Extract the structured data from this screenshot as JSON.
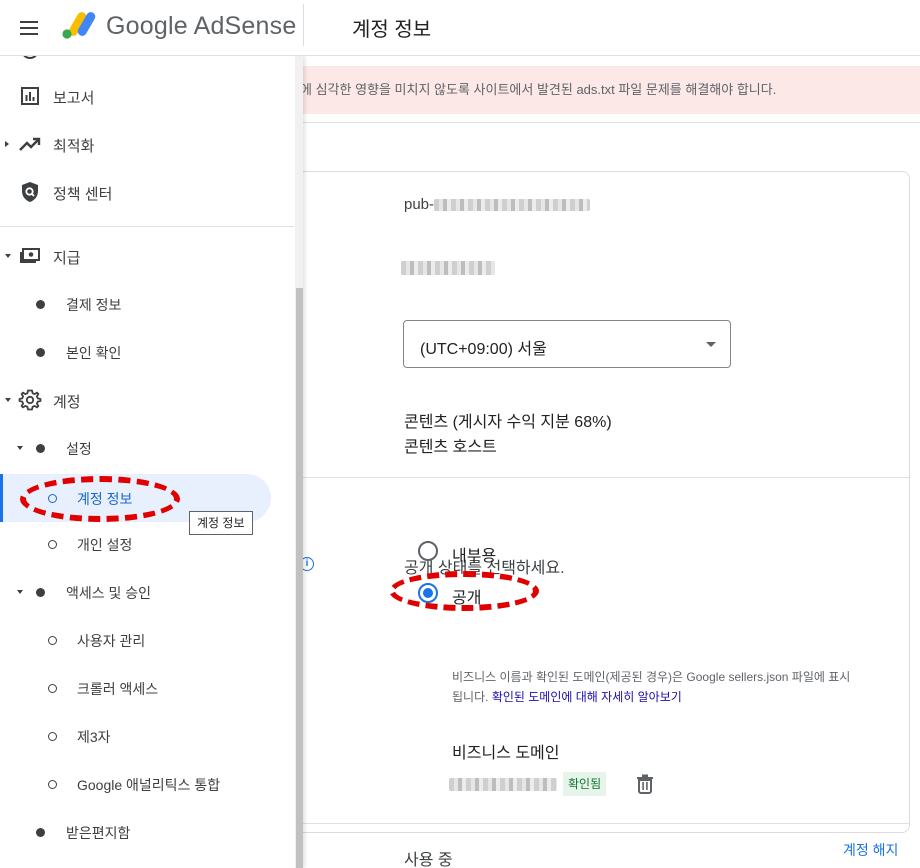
{
  "topbar": {
    "menu_icon": "hamburger-menu-icon",
    "brand": "Google AdSense",
    "page_title": "계정 정보"
  },
  "alert": {
    "text": "에 심각한 영향을 미치지 않도록 사이트에서 발견된 ads.txt 파일 문제를 해결해야 합니다."
  },
  "sidebar": {
    "items": [
      {
        "label": "보고서",
        "icon": "bar-chart-icon"
      },
      {
        "label": "최적화",
        "icon": "trending-up-icon"
      },
      {
        "label": "정책 센터",
        "icon": "policy-shield-icon"
      },
      {
        "label": "지급",
        "icon": "payments-icon"
      },
      {
        "label": "결제 정보"
      },
      {
        "label": "본인 확인"
      },
      {
        "label": "계정",
        "icon": "gear-icon"
      },
      {
        "label": "설정"
      },
      {
        "label": "계정 정보"
      },
      {
        "label": "개인 설정"
      },
      {
        "label": "액세스 및 승인"
      },
      {
        "label": "사용자 관리"
      },
      {
        "label": "크롤러 액세스"
      },
      {
        "label": "제3자"
      },
      {
        "label": "Google 애널리틱스 통합"
      },
      {
        "label": "받은편지함"
      }
    ],
    "tooltip": "계정 정보"
  },
  "account": {
    "publisher_id_prefix": "pub-",
    "timezone": "(UTC+09:00) 서울",
    "content_line1": "콘텐츠 (게시자 수익 지분 68%)",
    "content_line2": "콘텐츠 호스트",
    "visibility_prompt": "공개 상태를 선택하세요.",
    "visibility_options": [
      {
        "label": "내부용",
        "selected": false
      },
      {
        "label": "공개",
        "selected": true
      }
    ],
    "help_text": "비즈니스 이름과 확인된 도메인(제공된 경우)은 Google sellers.json 파일에 표시됩니다.",
    "help_link": "확인된 도메인에 대해 자세히 알아보기",
    "business_domain_title": "비즈니스 도메인",
    "verified_badge": "확인됨",
    "status": "사용 중",
    "close_account": "계정 해지"
  },
  "colors": {
    "accent": "#1a73e8",
    "alert_bg": "#fce8e6",
    "active_bg": "#e8f0fe",
    "verified_bg": "#e6f4ea",
    "annotation": "#e00000"
  }
}
